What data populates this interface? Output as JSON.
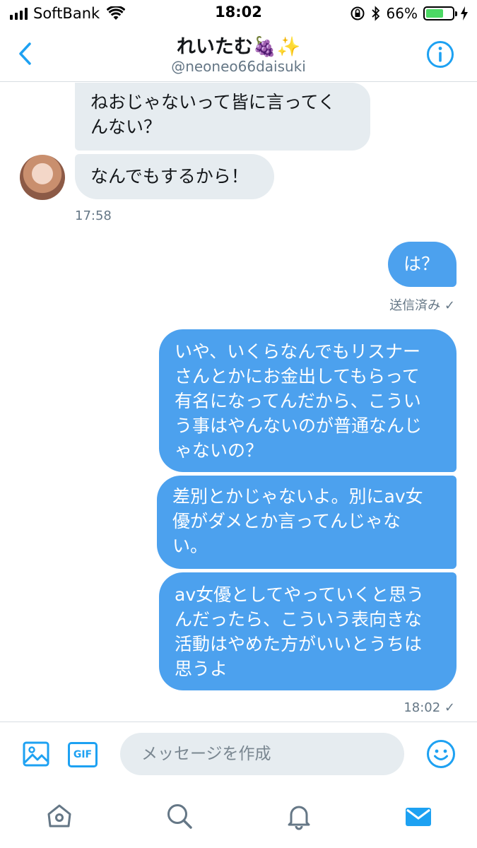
{
  "status_bar": {
    "carrier": "SoftBank",
    "time": "18:02",
    "battery": "66%",
    "battery_level": 0.66,
    "colors": {
      "battery_fill": "#4cd964"
    }
  },
  "header": {
    "title": "れいたむ🍇✨",
    "handle": "@neoneo66daisuki"
  },
  "messages": {
    "received": [
      {
        "text": "ねおじゃないって皆に言ってく\nんない？"
      },
      {
        "text": "なんでもするから！"
      }
    ],
    "received_time": "17:58",
    "sent_first": {
      "text": "は？"
    },
    "sent_status": "送信済み ✓",
    "sent": [
      {
        "text": "いや、いくらなんでもリスナー\nさんとかにお金出してもらって\n有名になってんだから、こうい\nう事はやんないのが普通なんじ\nゃないの？"
      },
      {
        "text": "差別とかじゃないよ。別にav女\n優がダメとか言ってんじゃな\nい。"
      },
      {
        "text": "av女優としてやっていくと思う\nんだったら、こういう表向きな\n活動はやめた方がいいとうちは\n思うよ"
      }
    ],
    "sent_time": "18:02 ✓"
  },
  "composer": {
    "placeholder": "メッセージを作成",
    "gif_label": "GIF"
  },
  "icons": {
    "back": "chevron-left-icon",
    "info": "info-icon",
    "image": "image-icon",
    "emoji": "smiley-icon",
    "home": "home-icon",
    "search": "search-icon",
    "notifications": "bell-icon",
    "messages": "mail-icon"
  },
  "colors": {
    "accent": "#1da1f2",
    "outgoing_bubble": "#4ca1ee",
    "incoming_bubble": "#e6ecf0",
    "secondary_text": "#657786"
  }
}
